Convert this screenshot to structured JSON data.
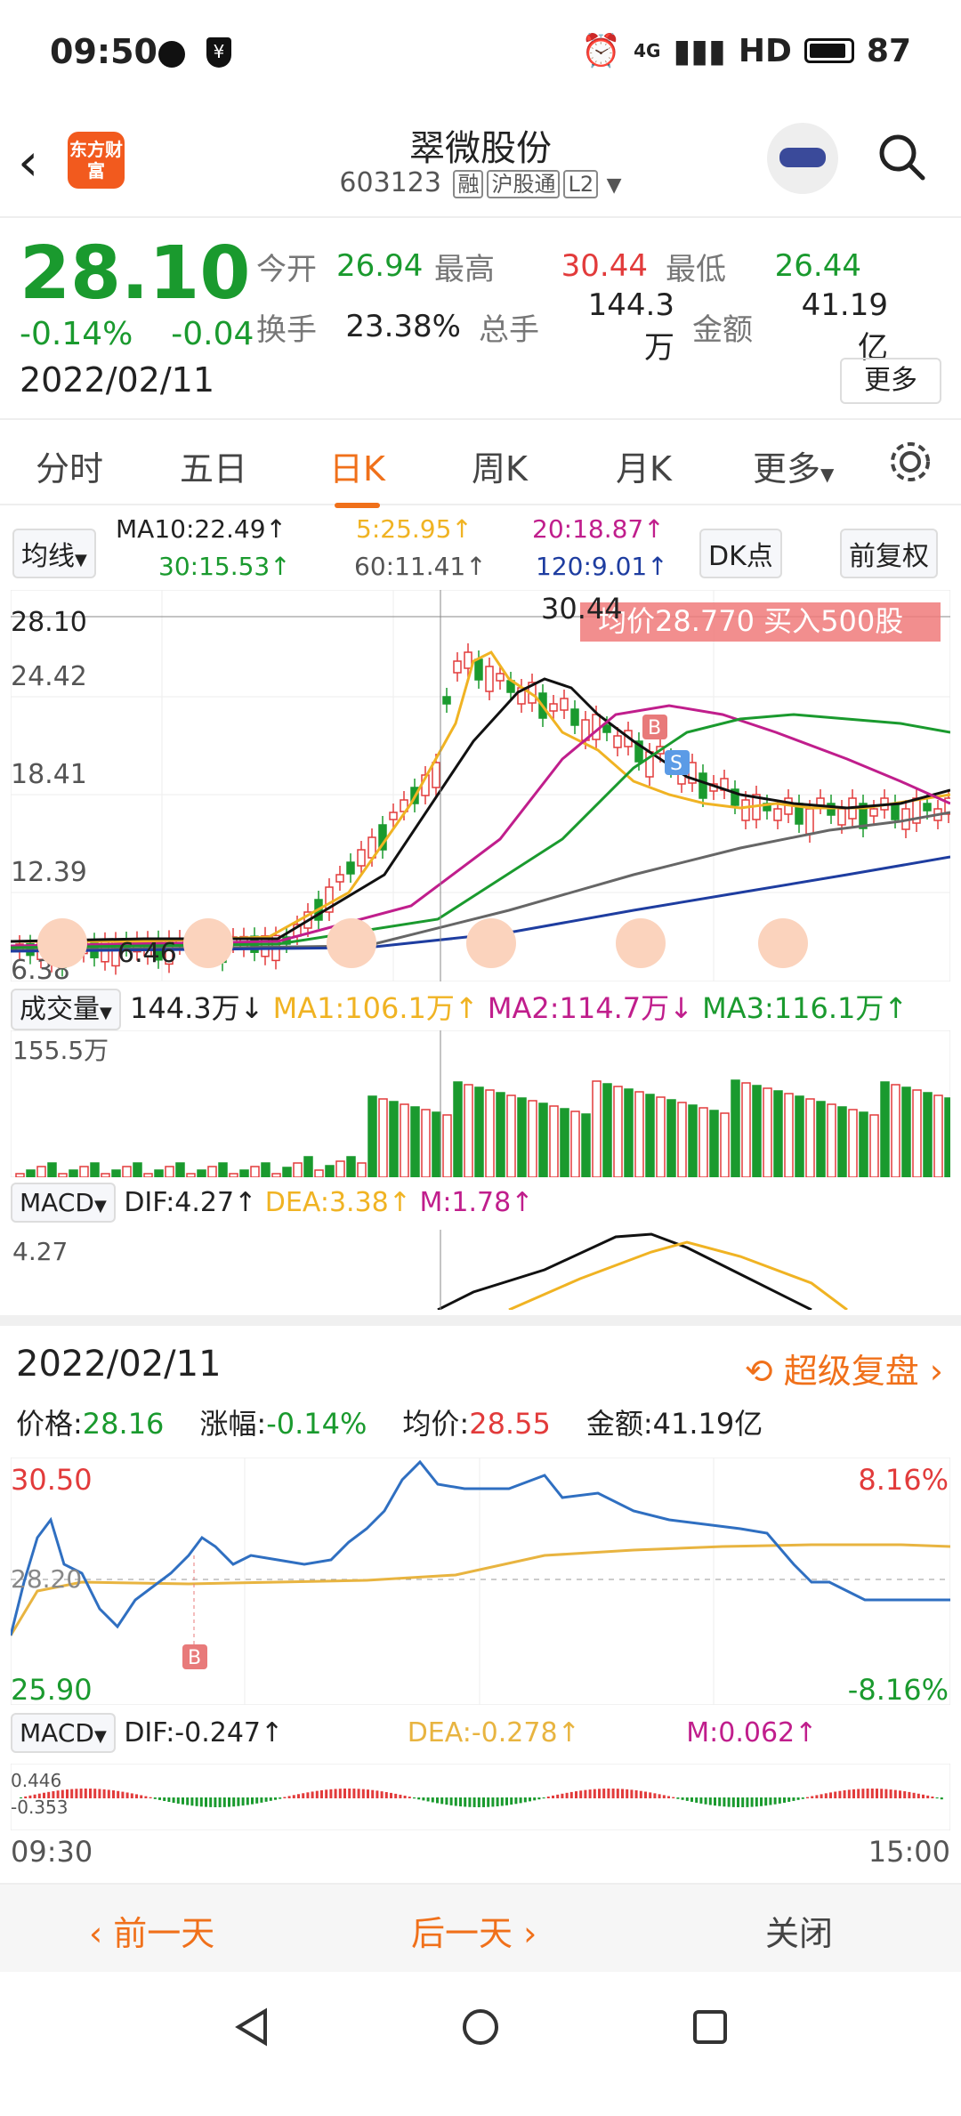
{
  "status": {
    "time": "09:50",
    "network": "4G",
    "hd": "HD",
    "battery": "87"
  },
  "header": {
    "title": "翠微股份",
    "code": "603123",
    "tags": [
      "融",
      "沪股通",
      "L2"
    ],
    "logo_text": "东方财富"
  },
  "quote": {
    "price": "28.10",
    "change_pct": "-0.14%",
    "change": "-0.04",
    "date": "2022/02/11",
    "fields": [
      {
        "label": "今开",
        "value": "26.94",
        "color": "green"
      },
      {
        "label": "最高",
        "value": "30.44",
        "color": "red"
      },
      {
        "label": "最低",
        "value": "26.44",
        "color": "green"
      },
      {
        "label": "换手",
        "value": "23.38%",
        "color": "black"
      },
      {
        "label": "总手",
        "value": "144.3万",
        "color": "black"
      },
      {
        "label": "金额",
        "value": "41.19亿",
        "color": "black"
      }
    ],
    "more": "更多"
  },
  "tabs": [
    "分时",
    "五日",
    "日K",
    "周K",
    "月K",
    "更多"
  ],
  "active_tab": "日K",
  "ma": {
    "selector": "均线",
    "ma10": "MA10:22.49↑",
    "ma5": "5:25.95↑",
    "ma20": "20:18.87↑",
    "ma30": "30:15.53↑",
    "ma60": "60:11.41↑",
    "ma120": "120:9.01↑",
    "dk": "DK点",
    "fq": "前复权"
  },
  "kline": {
    "y_labels": [
      "24.42",
      "18.41",
      "12.39",
      "6.38"
    ],
    "top_label": "30.44",
    "cross_label": "28.10",
    "low_label": "6.46",
    "banner": "均价28.770  买入500股",
    "marker_b": "B",
    "marker_s": "S"
  },
  "volume": {
    "selector": "成交量",
    "value": "144.3万↓",
    "ma1": "MA1:106.1万↑",
    "ma2": "MA2:114.7万↓",
    "ma3": "MA3:116.1万↑",
    "max": "155.5万"
  },
  "macd": {
    "selector": "MACD",
    "dif": "DIF:4.27↑",
    "dea": "DEA:3.38↑",
    "m": "M:1.78↑",
    "max": "4.27"
  },
  "intraday": {
    "date": "2022/02/11",
    "super": "超级复盘",
    "price_label": "价格:",
    "price": "28.16",
    "pct_label": "涨幅:",
    "pct": "-0.14%",
    "avg_label": "均价:",
    "avg": "28.55",
    "amt_label": "金额:",
    "amt": "41.19亿",
    "high": "30.50",
    "low": "25.90",
    "mid": "28.20",
    "pct_high": "8.16%",
    "pct_low": "-8.16%",
    "macd_sel": "MACD",
    "dif": "DIF:-0.247↑",
    "dea": "DEA:-0.278↑",
    "m": "M:0.062↑",
    "macd_hi": "0.446",
    "macd_lo": "-0.353",
    "t_start": "09:30",
    "t_end": "15:00",
    "marker_b": "B"
  },
  "bottom": {
    "prev": "前一天",
    "next": "后一天",
    "close": "关闭"
  },
  "colors": {
    "up": "#e23b3b",
    "down": "#1a9a2e",
    "accent": "#f0701a"
  }
}
